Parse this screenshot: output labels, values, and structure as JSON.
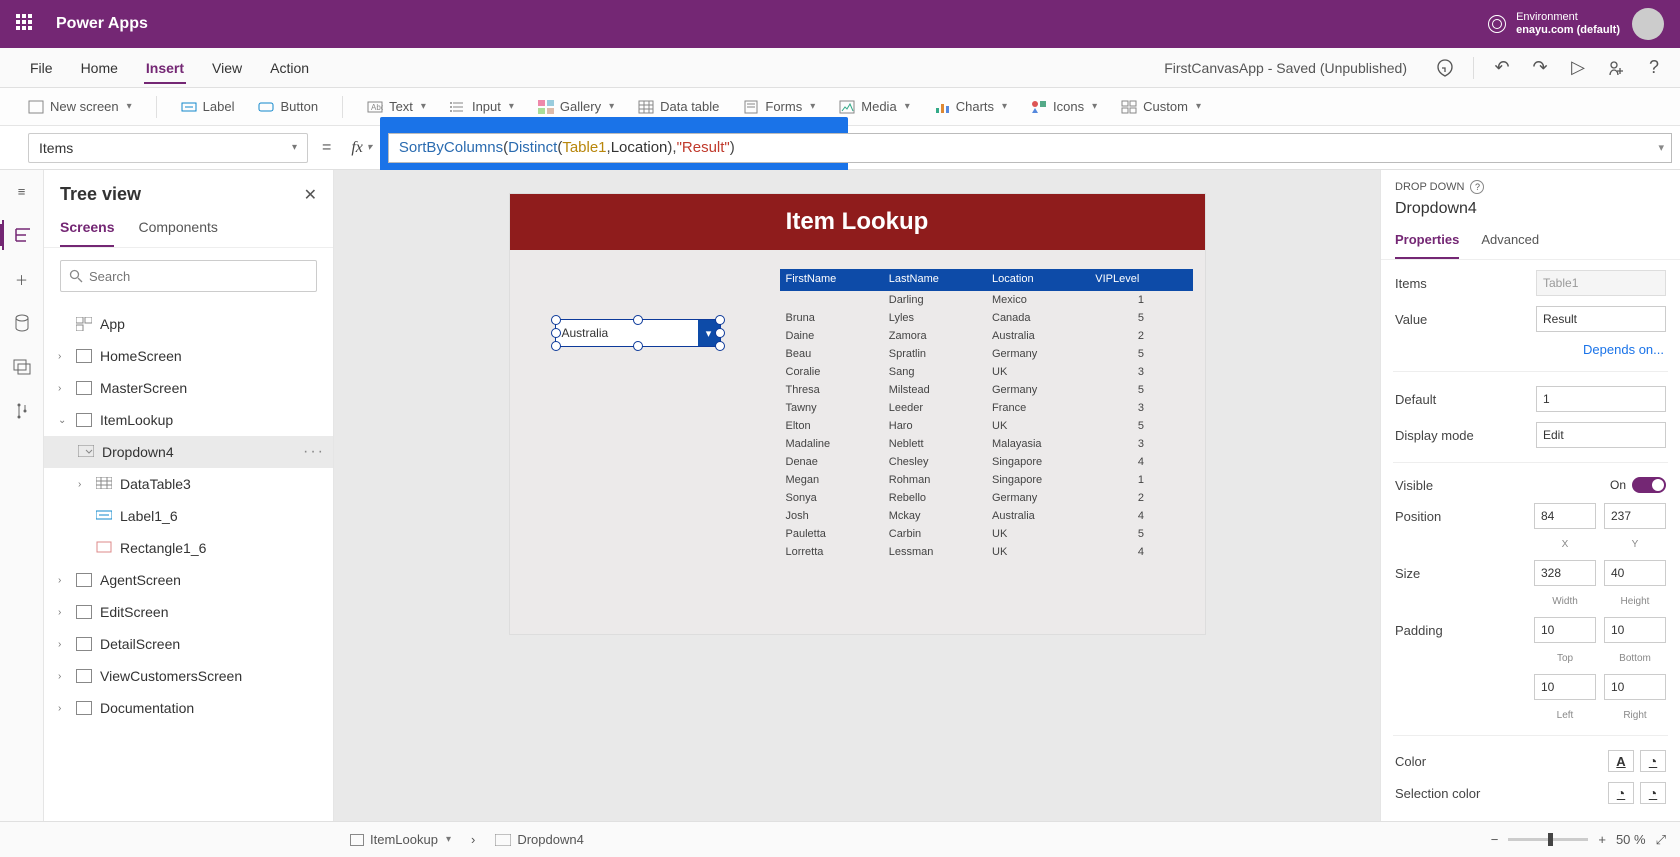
{
  "titlebar": {
    "brand": "Power Apps",
    "env_label": "Environment",
    "env_value": "enayu.com (default)"
  },
  "menubar": {
    "items": [
      "File",
      "Home",
      "Insert",
      "View",
      "Action"
    ],
    "active": "Insert",
    "app_status": "FirstCanvasApp - Saved (Unpublished)"
  },
  "ribbon": {
    "new_screen": "New screen",
    "label": "Label",
    "button": "Button",
    "text": "Text",
    "input": "Input",
    "gallery": "Gallery",
    "data_table": "Data table",
    "forms": "Forms",
    "media": "Media",
    "charts": "Charts",
    "icons": "Icons",
    "custom": "Custom"
  },
  "formula": {
    "property": "Items",
    "tokens": {
      "fn1": "SortByColumns",
      "fn2": "Distinct",
      "id1": "Table1",
      "arg1": "Location",
      "str1": "\"Result\""
    }
  },
  "tree": {
    "title": "Tree view",
    "tabs": {
      "screens": "Screens",
      "components": "Components"
    },
    "search_placeholder": "Search",
    "app": "App",
    "items": [
      {
        "name": "HomeScreen"
      },
      {
        "name": "MasterScreen"
      },
      {
        "name": "ItemLookup",
        "expanded": true,
        "children": [
          {
            "name": "Dropdown4",
            "selected": true
          },
          {
            "name": "DataTable3",
            "hasChildren": true
          },
          {
            "name": "Label1_6"
          },
          {
            "name": "Rectangle1_6"
          }
        ]
      },
      {
        "name": "AgentScreen"
      },
      {
        "name": "EditScreen"
      },
      {
        "name": "DetailScreen"
      },
      {
        "name": "ViewCustomersScreen"
      },
      {
        "name": "Documentation"
      }
    ]
  },
  "preview": {
    "header": "Item Lookup",
    "dropdown_value": "Australia",
    "table": {
      "headers": [
        "FirstName",
        "LastName",
        "Location",
        "VIPLevel"
      ],
      "rows": [
        [
          "",
          "Darling",
          "Mexico",
          "1"
        ],
        [
          "Bruna",
          "Lyles",
          "Canada",
          "5"
        ],
        [
          "Daine",
          "Zamora",
          "Australia",
          "2"
        ],
        [
          "Beau",
          "Spratlin",
          "Germany",
          "5"
        ],
        [
          "Coralie",
          "Sang",
          "UK",
          "3"
        ],
        [
          "Thresa",
          "Milstead",
          "Germany",
          "5"
        ],
        [
          "Tawny",
          "Leeder",
          "France",
          "3"
        ],
        [
          "Elton",
          "Haro",
          "UK",
          "5"
        ],
        [
          "Madaline",
          "Neblett",
          "Malayasia",
          "3"
        ],
        [
          "Denae",
          "Chesley",
          "Singapore",
          "4"
        ],
        [
          "Megan",
          "Rohman",
          "Singapore",
          "1"
        ],
        [
          "Sonya",
          "Rebello",
          "Germany",
          "2"
        ],
        [
          "Josh",
          "Mckay",
          "Australia",
          "4"
        ],
        [
          "Pauletta",
          "Carbin",
          "UK",
          "5"
        ],
        [
          "Lorretta",
          "Lessman",
          "UK",
          "4"
        ]
      ]
    }
  },
  "props": {
    "section": "DROP DOWN",
    "control": "Dropdown4",
    "tabs": {
      "properties": "Properties",
      "advanced": "Advanced"
    },
    "items_label": "Items",
    "items_value": "Table1",
    "value_label": "Value",
    "value_value": "Result",
    "depends": "Depends on...",
    "default_label": "Default",
    "default_value": "1",
    "display_mode_label": "Display mode",
    "display_mode_value": "Edit",
    "visible_label": "Visible",
    "visible_on": "On",
    "position_label": "Position",
    "pos_x": "84",
    "pos_y": "237",
    "pos_x_sub": "X",
    "pos_y_sub": "Y",
    "size_label": "Size",
    "size_w": "328",
    "size_h": "40",
    "size_w_sub": "Width",
    "size_h_sub": "Height",
    "padding_label": "Padding",
    "pad_t": "10",
    "pad_b": "10",
    "pad_t_sub": "Top",
    "pad_b_sub": "Bottom",
    "pad_l": "10",
    "pad_r": "10",
    "pad_l_sub": "Left",
    "pad_r_sub": "Right",
    "color_label": "Color",
    "selection_color_label": "Selection color"
  },
  "bottombar": {
    "crumb1": "ItemLookup",
    "crumb2": "Dropdown4",
    "zoom": "50"
  }
}
